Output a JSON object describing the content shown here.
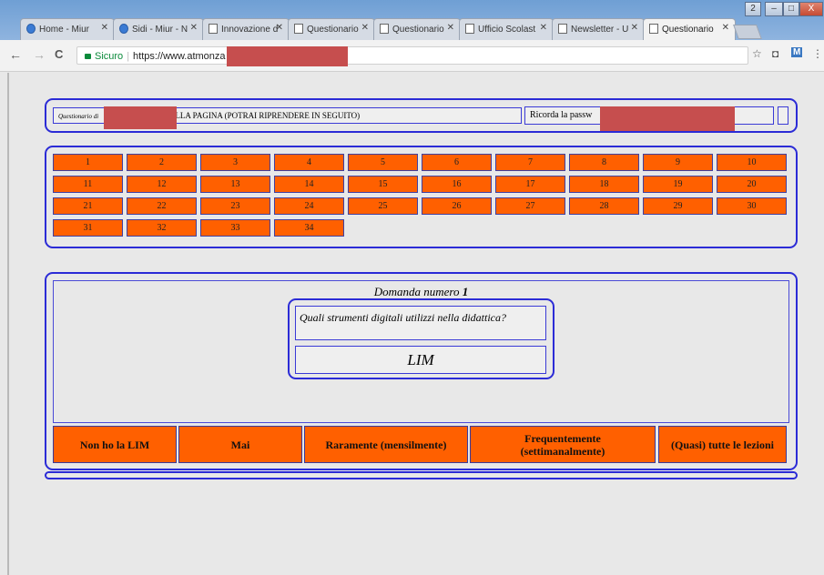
{
  "browser": {
    "tabs": [
      {
        "label": "Home - Miur",
        "icon": "globe-icon"
      },
      {
        "label": "Sidi - Miur - N",
        "icon": "globe-icon"
      },
      {
        "label": "Innovazione d",
        "icon": "page-icon"
      },
      {
        "label": "Questionario",
        "icon": "page-icon"
      },
      {
        "label": "Questionario",
        "icon": "page-icon"
      },
      {
        "label": "Ufficio Scolast",
        "icon": "page-icon"
      },
      {
        "label": "Newsletter - U",
        "icon": "page-icon"
      },
      {
        "label": "Questionario",
        "icon": "page-icon"
      }
    ],
    "tab_close": "✕",
    "address": {
      "secure_label": "Sicuro",
      "separator": "|",
      "url": "https://www.atmonza"
    },
    "nav": {
      "back": "←",
      "forward": "→",
      "reload": "C"
    },
    "toolbar_icons": {
      "star": "☆",
      "camera": "◘",
      "extension": "M",
      "menu": "⋮"
    },
    "window_controls": {
      "minimize": "–",
      "maximize": "□",
      "close": "X",
      "extra": "2"
    }
  },
  "header": {
    "quiz_label": "Questionario di",
    "exit_text": "SCI DALLA PAGINA (POTRAI RIPRENDERE IN SEGUITO)",
    "remember_text": "Ricorda la passw"
  },
  "question_numbers": [
    "1",
    "2",
    "3",
    "4",
    "5",
    "6",
    "7",
    "8",
    "9",
    "10",
    "11",
    "12",
    "13",
    "14",
    "15",
    "16",
    "17",
    "18",
    "19",
    "20",
    "21",
    "22",
    "23",
    "24",
    "25",
    "26",
    "27",
    "28",
    "29",
    "30",
    "31",
    "32",
    "33",
    "34"
  ],
  "question": {
    "title_prefix": "Domanda numero",
    "number": "1",
    "text": "Quali strumenti digitali utilizzi nella didattica?",
    "item": "LIM"
  },
  "answers": [
    "Non ho la LIM",
    "Mai",
    "Raramente (mensilmente)",
    "Frequentemente (settimanalmente)",
    "(Quasi) tutte le lezioni"
  ],
  "colors": {
    "accent": "#ff6000",
    "border": "#2b2bd6",
    "redaction": "#c64e4e"
  }
}
